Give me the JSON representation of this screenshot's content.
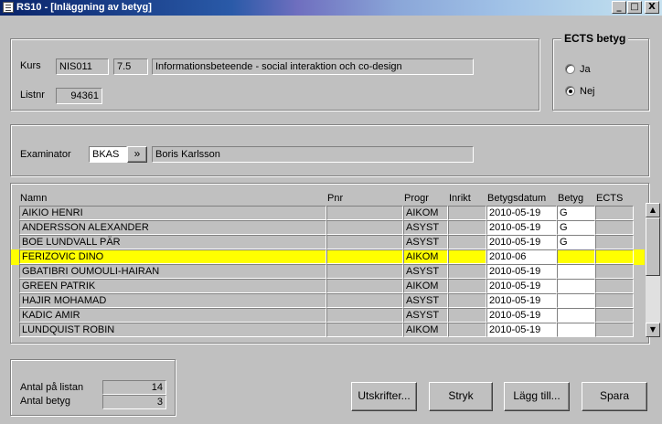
{
  "window": {
    "title": "RS10 - [Inläggning av betyg]",
    "controls": {
      "minimize": "_",
      "maximize": "□",
      "close": "X"
    }
  },
  "course": {
    "kurs_label": "Kurs",
    "code": "NIS011",
    "credits": "7.5",
    "name": "Informationsbeteende - social interaktion och co-design",
    "listnr_label": "Listnr",
    "listnr": "94361"
  },
  "ects": {
    "title": "ECTS betyg",
    "options": [
      {
        "label": "Ja",
        "selected": false
      },
      {
        "label": "Nej",
        "selected": true
      }
    ]
  },
  "examinator": {
    "label": "Examinator",
    "code": "BKAS",
    "lookup_label": "»",
    "name": "Boris Karlsson"
  },
  "grid": {
    "headers": {
      "namn": "Namn",
      "pnr": "Pnr",
      "progr": "Progr",
      "inrikt": "Inrikt",
      "datum": "Betygsdatum",
      "betyg": "Betyg",
      "ects": "ECTS"
    },
    "rows": [
      {
        "namn": "AIKIO HENRI",
        "pnr": "",
        "progr": "AIKOM",
        "inrikt": "",
        "datum": "2010-05-19",
        "betyg": "G",
        "ects": ""
      },
      {
        "namn": "ANDERSSON ALEXANDER",
        "pnr": "",
        "progr": "ASYST",
        "inrikt": "",
        "datum": "2010-05-19",
        "betyg": "G",
        "ects": ""
      },
      {
        "namn": "BOE LUNDVALL PÄR",
        "pnr": "",
        "progr": "ASYST",
        "inrikt": "",
        "datum": "2010-05-19",
        "betyg": "G",
        "ects": ""
      },
      {
        "namn": "FERIZOVIC DINO",
        "pnr": "",
        "progr": "AIKOM",
        "inrikt": "",
        "datum": "2010-06",
        "betyg": "",
        "ects": ""
      },
      {
        "namn": "GBATIBRI OUMOULI-HAIRAN",
        "pnr": "",
        "progr": "ASYST",
        "inrikt": "",
        "datum": "2010-05-19",
        "betyg": "",
        "ects": ""
      },
      {
        "namn": "GREEN PATRIK",
        "pnr": "",
        "progr": "AIKOM",
        "inrikt": "",
        "datum": "2010-05-19",
        "betyg": "",
        "ects": ""
      },
      {
        "namn": "HAJIR MOHAMAD",
        "pnr": "",
        "progr": "ASYST",
        "inrikt": "",
        "datum": "2010-05-19",
        "betyg": "",
        "ects": ""
      },
      {
        "namn": "KADIC AMIR",
        "pnr": "",
        "progr": "ASYST",
        "inrikt": "",
        "datum": "2010-05-19",
        "betyg": "",
        "ects": ""
      },
      {
        "namn": "LUNDQUIST ROBIN",
        "pnr": "",
        "progr": "AIKOM",
        "inrikt": "",
        "datum": "2010-05-19",
        "betyg": "",
        "ects": ""
      }
    ]
  },
  "summary": {
    "antal_listan_label": "Antal på listan",
    "antal_listan": "14",
    "antal_betyg_label": "Antal betyg",
    "antal_betyg": "3"
  },
  "buttons": {
    "utskrifter": "Utskrifter...",
    "stryk": "Stryk",
    "lagg_till": "Lägg till...",
    "spara": "Spara"
  },
  "colors": {
    "selected_row": "#ffff00",
    "window_bg": "#c0c0c0",
    "titlebar": "#0a246a"
  }
}
